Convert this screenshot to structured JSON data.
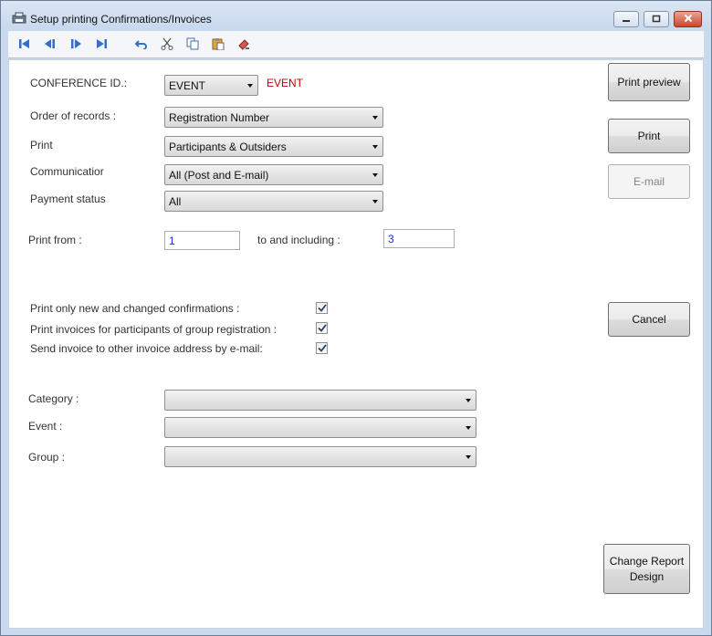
{
  "window": {
    "title": "Setup printing Confirmations/Invoices",
    "controls": {
      "minimize_icon": "minimize-icon",
      "maximize_icon": "maximize-icon",
      "close_icon": "close-icon"
    }
  },
  "toolbar": {
    "icons": [
      "first-record-icon",
      "previous-record-icon",
      "next-record-icon",
      "last-record-icon",
      "undo-icon",
      "cut-icon",
      "copy-icon",
      "paste-icon",
      "eraser-icon"
    ]
  },
  "form": {
    "conference_id": {
      "label": "CONFERENCE ID.:",
      "value": "EVENT",
      "display": "EVENT",
      "display_color": "#cc0000"
    },
    "order_of_records": {
      "label": "Order of records :",
      "value": "Registration Number"
    },
    "print": {
      "label": "Print",
      "value": "Participants & Outsiders"
    },
    "communication": {
      "label": "Communicatior",
      "value": "All (Post and E-mail)"
    },
    "payment_status": {
      "label": "Payment status",
      "value": "All"
    },
    "print_from": {
      "label": "Print from :",
      "value": "1"
    },
    "to_including": {
      "label": "to and including :",
      "value": "3"
    },
    "checkboxes": [
      {
        "label": "Print only new and changed confirmations :",
        "checked": true
      },
      {
        "label": "Print invoices for participants of group registration :",
        "checked": true
      },
      {
        "label": "Send invoice to other invoice address by e-mail:",
        "checked": true
      }
    ],
    "category": {
      "label": "Category :",
      "value": ""
    },
    "event": {
      "label": "Event :",
      "value": ""
    },
    "group": {
      "label": "Group :",
      "value": ""
    }
  },
  "buttons": {
    "print_preview": "Print preview",
    "print": "Print",
    "email": "E-mail",
    "cancel": "Cancel",
    "change_report_design": "Change Report Design"
  }
}
